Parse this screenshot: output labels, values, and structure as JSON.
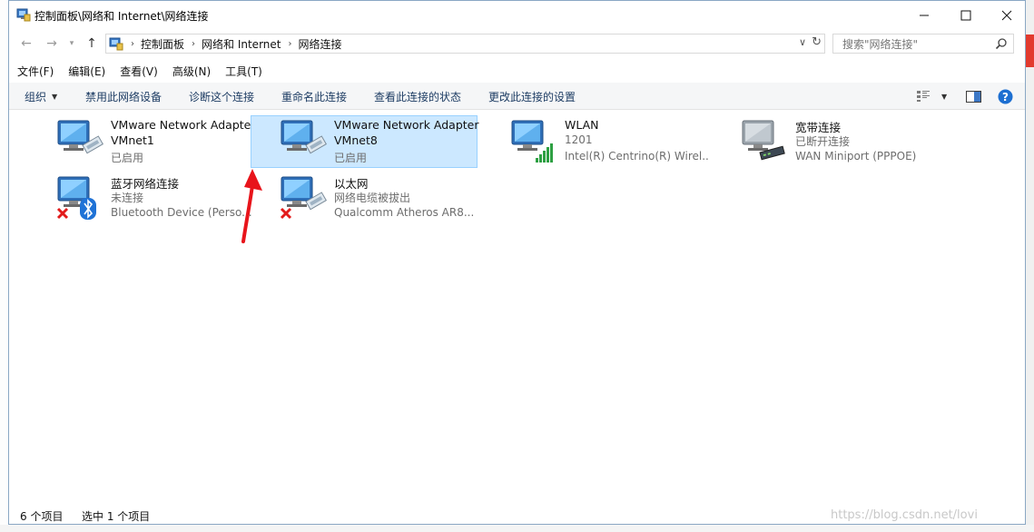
{
  "window": {
    "title": "控制面板\\网络和 Internet\\网络连接"
  },
  "address": {
    "crumbs": [
      "控制面板",
      "网络和 Internet",
      "网络连接"
    ],
    "search_placeholder": "搜索\"网络连接\""
  },
  "menu": [
    "文件(F)",
    "编辑(E)",
    "查看(V)",
    "高级(N)",
    "工具(T)"
  ],
  "commands": {
    "organize": "组织",
    "disable": "禁用此网络设备",
    "diagnose": "诊断这个连接",
    "rename": "重命名此连接",
    "view_status": "查看此连接的状态",
    "change_settings": "更改此连接的设置"
  },
  "connections": [
    {
      "name": "VMware Network Adapter",
      "name2": "VMnet1",
      "status": "已启用",
      "icon": "ethernet-adapter-icon",
      "selected": false
    },
    {
      "name": "VMware Network Adapter",
      "name2": "VMnet8",
      "status": "已启用",
      "icon": "ethernet-adapter-icon",
      "selected": true
    },
    {
      "name": "WLAN",
      "status": "1201",
      "device": "Intel(R) Centrino(R) Wirel...",
      "icon": "wifi-signal-icon"
    },
    {
      "name": "宽带连接",
      "status": "已断开连接",
      "device": "WAN Miniport (PPPOE)",
      "icon": "modem-icon"
    },
    {
      "name": "蓝牙网络连接",
      "status": "未连接",
      "device": "Bluetooth Device (Perso...",
      "icon": "bluetooth-icon"
    },
    {
      "name": "以太网",
      "status": "网络电缆被拔出",
      "device": "Qualcomm Atheros AR8...",
      "icon": "ethernet-disconnected-icon"
    }
  ],
  "statusbar": {
    "count": "6 个项目",
    "selected": "选中 1 个项目",
    "watermark": "https://blog.csdn.net/lovi"
  },
  "colors": {
    "selection_bg": "#cce8ff",
    "selection_border": "#99d1ff",
    "command_text": "#1e3d64",
    "annotation_arrow": "#e8141b"
  }
}
